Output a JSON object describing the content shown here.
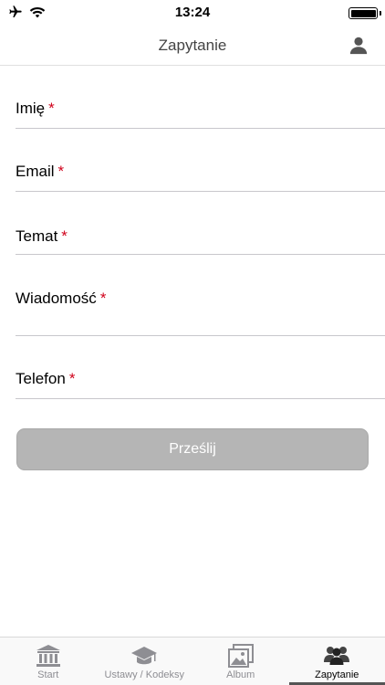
{
  "status_bar": {
    "time": "13:24",
    "icons": [
      "airplane-icon",
      "wifi-icon",
      "battery-icon"
    ],
    "battery_level": 1.0
  },
  "nav": {
    "title": "Zapytanie",
    "right_icon": "user-icon"
  },
  "form": {
    "required_marker": "*",
    "fields": [
      {
        "label": "Imię",
        "required": true,
        "value": ""
      },
      {
        "label": "Email",
        "required": true,
        "value": ""
      },
      {
        "label": "Temat",
        "required": true,
        "value": ""
      },
      {
        "label": "Wiadomość",
        "required": true,
        "value": ""
      },
      {
        "label": "Telefon",
        "required": true,
        "value": ""
      }
    ],
    "submit_label": "Prześlij"
  },
  "tabs": [
    {
      "label": "Start",
      "icon": "bank-icon",
      "active": false
    },
    {
      "label": "Ustawy / Kodeksy",
      "icon": "graduation-cap-icon",
      "active": false
    },
    {
      "label": "Album",
      "icon": "photo-album-icon",
      "active": false
    },
    {
      "label": "Zapytanie",
      "icon": "users-icon",
      "active": true
    }
  ],
  "colors": {
    "required": "#d0021b",
    "button_bg": "#b5b5b5",
    "tab_inactive": "#8e8e93",
    "tab_indicator": "#555555"
  }
}
